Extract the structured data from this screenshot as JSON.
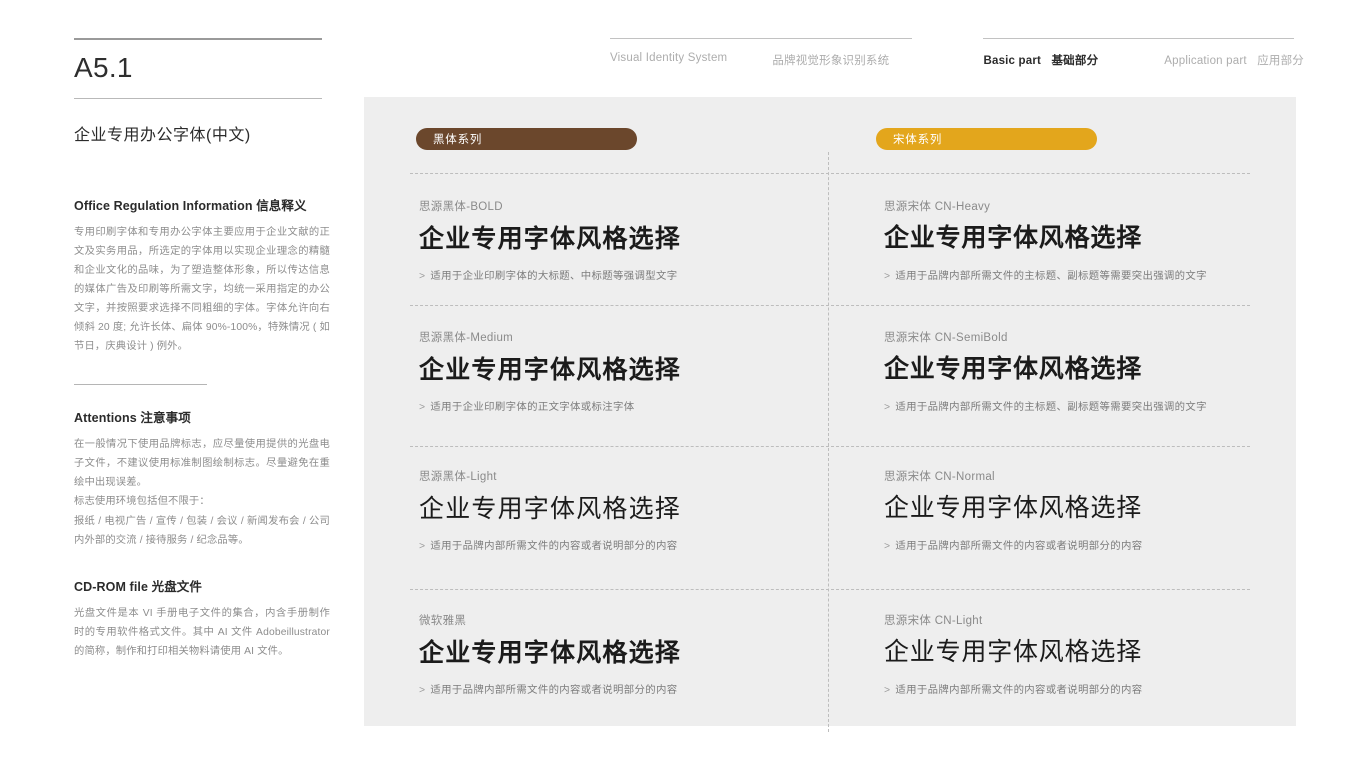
{
  "sidebar": {
    "section_code": "A5.1",
    "section_title": "企业专用办公字体(中文)",
    "blocks": [
      {
        "heading_en": "Office Regulation Information",
        "heading_cn": "信息释义",
        "body": "专用印刷字体和专用办公字体主要应用于企业文献的正文及实务用品，所选定的字体用以实现企业理念的精髓和企业文化的品味，为了塑造整体形象，所以传达信息的媒体广告及印刷等所需文字，均统一采用指定的办公文字，并按照要求选择不同粗细的字体。字体允许向右倾斜 20 度; 允许长体、扁体 90%-100%，特殊情况 ( 如节日，庆典设计 ) 例外。"
      },
      {
        "heading_en": "Attentions",
        "heading_cn": "注意事项",
        "body": "在一般情况下使用品牌标志，应尽量使用提供的光盘电子文件，不建议使用标准制图绘制标志。尽量避免在重绘中出现误差。\n标志使用环境包括但不限于：\n报纸 / 电视广告 / 宣传 / 包装 / 会议 / 新闻发布会 / 公司内外部的交流 / 接待服务 / 纪念品等。"
      },
      {
        "heading_en": "CD-ROM file",
        "heading_cn": "光盘文件",
        "body": "光盘文件是本 VI 手册电子文件的集合，内含手册制作时的专用软件格式文件。其中 AI 文件 Adobeillustrator 的简称，制作和打印相关物料请使用 AI 文件。"
      }
    ]
  },
  "nav": {
    "visual_identity": {
      "en": "Visual Identity System",
      "cn": ""
    },
    "brand_system": {
      "en": "",
      "cn": "品牌视觉形象识别系统"
    },
    "basic_part": {
      "en": "Basic part",
      "cn": "基础部分"
    },
    "application_part": {
      "en": "Application part",
      "cn": "应用部分"
    }
  },
  "panel": {
    "badges": [
      {
        "label": "黑体系列",
        "color": "#6b472c"
      },
      {
        "label": "宋体系列",
        "color": "#e3a61c"
      }
    ],
    "columns": [
      {
        "family": "sans",
        "specimens": [
          {
            "name": "思源黑体-BOLD",
            "sample": "企业专用字体风格选择",
            "note": "适用于企业印刷字体的大标题、中标题等强调型文字",
            "weight": "bold"
          },
          {
            "name": "思源黑体-Medium",
            "sample": "企业专用字体风格选择",
            "note": "适用于企业印刷字体的正文字体或标注字体",
            "weight": "medium"
          },
          {
            "name": "思源黑体-Light",
            "sample": "企业专用字体风格选择",
            "note": "适用于品牌内部所需文件的内容或者说明部分的内容",
            "weight": "light"
          },
          {
            "name": "微软雅黑",
            "sample": "企业专用字体风格选择",
            "note": "适用于品牌内部所需文件的内容或者说明部分的内容",
            "weight": "normal"
          }
        ]
      },
      {
        "family": "serif",
        "specimens": [
          {
            "name": "思源宋体 CN-Heavy",
            "sample": "企业专用字体风格选择",
            "note": "适用于品牌内部所需文件的主标题、副标题等需要突出强调的文字",
            "weight": "bold"
          },
          {
            "name": "思源宋体 CN-SemiBold",
            "sample": "企业专用字体风格选择",
            "note": "适用于品牌内部所需文件的主标题、副标题等需要突出强调的文字",
            "weight": "medium"
          },
          {
            "name": "思源宋体 CN-Normal",
            "sample": "企业专用字体风格选择",
            "note": "适用于品牌内部所需文件的内容或者说明部分的内容",
            "weight": "normal"
          },
          {
            "name": "思源宋体 CN-Light",
            "sample": "企业专用字体风格选择",
            "note": "适用于品牌内部所需文件的内容或者说明部分的内容",
            "weight": "light"
          }
        ]
      }
    ],
    "note_chevron": ">"
  },
  "colors": {
    "panel_bg": "#eeeeee",
    "hei_badge": "#6b472c",
    "song_badge": "#e3a61c",
    "ink": "#1b1b1b",
    "muted": "#8d8d8d"
  }
}
